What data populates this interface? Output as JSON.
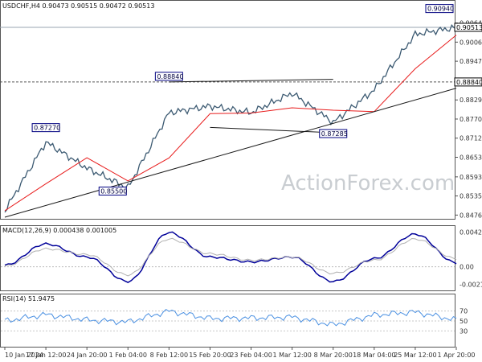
{
  "watermark": "ActionForex.com",
  "chart_data": [
    {
      "type": "candlestick",
      "title": "USDCHF,H4 0.90473 0.90515 0.90472 0.90513",
      "ylim": [
        0.847,
        0.913
      ],
      "y_ticks": [
        "0.90645",
        "0.90060",
        "0.89475",
        "0.88890",
        "0.88290",
        "0.87705",
        "0.87120",
        "0.86535",
        "0.85935",
        "0.85350",
        "0.84765"
      ],
      "current_price": "0.90513",
      "horizontal_level": "0.88840",
      "x_ticks": [
        "10 Jan 2024",
        "17 Jan 12:00",
        "24 Jan 20:00",
        "1 Feb 04:00",
        "8 Feb 12:00",
        "15 Feb 20:00",
        "23 Feb 04:00",
        "1 Mar 12:00",
        "8 Mar 20:00",
        "18 Mar 04:00",
        "25 Mar 12:00",
        "1 Apr 20:00"
      ],
      "annotations": [
        {
          "label": "0.85500",
          "value": 0.855,
          "x_label": "1 Feb 04:00"
        },
        {
          "label": "0.87270",
          "value": 0.8727,
          "x_label": "17 Jan 12:00"
        },
        {
          "label": "0.88840",
          "value": 0.8884,
          "x_label": "8 Feb 12:00"
        },
        {
          "label": "0.87285",
          "value": 0.87285,
          "x_label": "8 Mar 20:00"
        },
        {
          "label": "0.90940",
          "value": 0.9094,
          "x_label": "1 Apr 20:00"
        }
      ],
      "price_path": [
        {
          "x": "10 Jan 2024",
          "y": 0.849
        },
        {
          "x": "17 Jan 12:00",
          "y": 0.87
        },
        {
          "x": "24 Jan 20:00",
          "y": 0.862
        },
        {
          "x": "1 Feb 04:00",
          "y": 0.856
        },
        {
          "x": "8 Feb 12:00",
          "y": 0.879
        },
        {
          "x": "15 Feb 20:00",
          "y": 0.881
        },
        {
          "x": "23 Feb 04:00",
          "y": 0.879
        },
        {
          "x": "1 Mar 12:00",
          "y": 0.885
        },
        {
          "x": "8 Mar 20:00",
          "y": 0.876
        },
        {
          "x": "18 Mar 04:00",
          "y": 0.886
        },
        {
          "x": "25 Mar 12:00",
          "y": 0.903
        },
        {
          "x": "1 Apr 20:00",
          "y": 0.9051
        }
      ],
      "colors": {
        "price": "#3c5a72",
        "ma": "#e81c1c",
        "trendline": "#1a1a1a",
        "flag_border": "#000080"
      }
    },
    {
      "type": "line",
      "title": "MACD(12,26,9) 0.000438 0.001005",
      "ylim": [
        -0.0028,
        0.0048
      ],
      "y_ticks": [
        "0.004237",
        "0.00",
        "-0.002142"
      ],
      "series": [
        {
          "values": [
            0.0002,
            0.0028,
            0.0012,
            -0.0018,
            0.0042,
            0.0012,
            0.0006,
            0.0012,
            -0.0018,
            0.001,
            0.004,
            0.0005
          ]
        },
        {
          "values": [
            0.0001,
            0.0022,
            0.0015,
            -0.001,
            0.0034,
            0.0016,
            0.0008,
            0.0012,
            -0.0008,
            0.0008,
            0.0034,
            0.001
          ]
        }
      ],
      "colors": {
        "macd": "#000099",
        "signal": "#b0b0b0"
      }
    },
    {
      "type": "line",
      "title": "RSI(14) 51.9475",
      "ylim": [
        0,
        100
      ],
      "y_ticks": [
        "70",
        "50",
        "30"
      ],
      "series": [
        {
          "values": [
            50,
            63,
            52,
            48,
            70,
            55,
            56,
            58,
            42,
            62,
            68,
            52
          ]
        }
      ],
      "colors": {
        "rsi": "#4a90e2"
      }
    }
  ]
}
